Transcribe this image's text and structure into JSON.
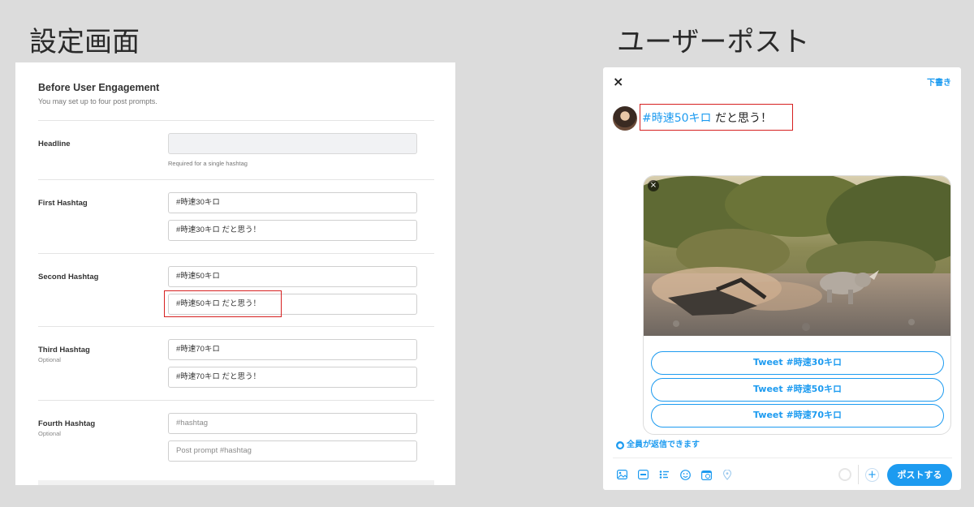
{
  "titles": {
    "settings": "設定画面",
    "user_post": "ユーザーポスト"
  },
  "settings": {
    "heading": "Before User Engagement",
    "subheading": "You may set up to four post prompts.",
    "headline": {
      "label": "Headline",
      "value": "",
      "help": "Required for a single hashtag"
    },
    "first": {
      "label": "First Hashtag",
      "hashtag": "#時速30キロ",
      "prompt": "#時速30キロ だと思う！"
    },
    "second": {
      "label": "Second Hashtag",
      "hashtag": "#時速50キロ",
      "prompt": "#時速50キロ だと思う！"
    },
    "third": {
      "label": "Third Hashtag",
      "optional": "Optional",
      "hashtag": "#時速70キロ",
      "prompt": "#時速70キロ だと思う！"
    },
    "fourth": {
      "label": "Fourth Hashtag",
      "optional": "Optional",
      "hashtag_placeholder": "#hashtag",
      "prompt_placeholder": "Post prompt #hashtag"
    }
  },
  "composer": {
    "close": "×",
    "draft": "下書き",
    "tweet_tag": "#時速50キロ",
    "tweet_rest": " だと思う！",
    "photo_close": "×",
    "poll": [
      "Tweet #時速30キロ",
      "Tweet #時速50キロ",
      "Tweet #時速70キロ"
    ],
    "reply_info": "全員が返信できます",
    "post_button": "ポストする",
    "plus": "+",
    "accent_color": "#1d9bf0",
    "highlight_color": "#d62020",
    "icons": [
      "image-icon",
      "gif-icon",
      "poll-icon",
      "emoji-icon",
      "schedule-icon",
      "location-icon",
      "globe-icon",
      "avatar"
    ]
  }
}
